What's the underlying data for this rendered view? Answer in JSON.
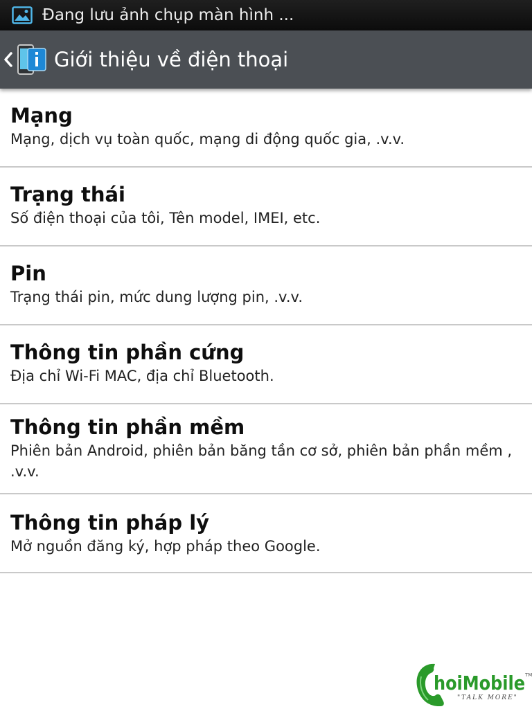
{
  "status_bar": {
    "icon": "gallery-image-icon",
    "notification": "Đang lưu ảnh chụp màn hình ..."
  },
  "action_bar": {
    "back_icon": "chevron-left-icon",
    "app_icon": "phone-info-icon",
    "title": "Giới thiệu về điện thoại"
  },
  "items": [
    {
      "title": "Mạng",
      "summary": "Mạng, dịch vụ toàn quốc, mạng di động quốc gia, .v.v."
    },
    {
      "title": "Trạng thái",
      "summary": "Số điện thoại của tôi, Tên model, IMEI, etc."
    },
    {
      "title": "Pin",
      "summary": "Trạng thái pin, mức dung lượng pin, .v.v."
    },
    {
      "title": "Thông tin phần cứng",
      "summary": "Địa chỉ Wi-Fi MAC, địa chỉ Bluetooth."
    },
    {
      "title": "Thông tin phần mềm",
      "summary": "Phiên bản Android, phiên bản băng tần cơ sở, phiên bản phần mềm , .v.v."
    },
    {
      "title": "Thông tin pháp lý",
      "summary": "Mở nguồn đăng ký, hợp pháp theo Google."
    }
  ],
  "watermark": {
    "logo": "choimobile-logo",
    "brand": "hoiMobile",
    "tm": "TM",
    "tagline": "\"TALK MORE\""
  },
  "colors": {
    "status_bar": "#111111",
    "action_bar": "#4b4f54",
    "divider": "#c9c9c9",
    "accent_blue": "#1e88d6",
    "watermark_green": "#2a9a2a"
  }
}
